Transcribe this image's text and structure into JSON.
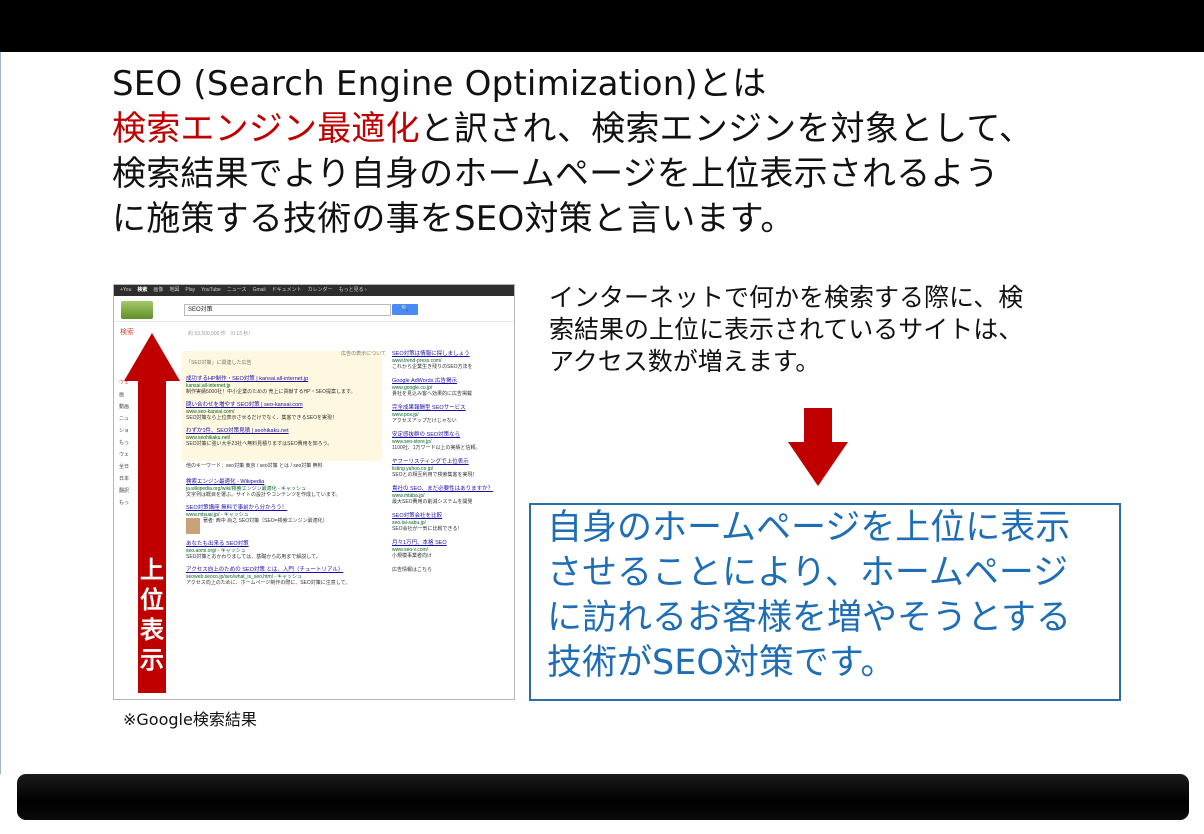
{
  "heading": {
    "line1": "SEO (Search Engine Optimization)とは",
    "line2_red": "検索エンジン最適化",
    "line2_rest": "と訳され、検索エンジンを対象として、",
    "line3": "検索結果でより自身のホームページを上位表示されるよう",
    "line4": "に施策する技術の事をSEO対策と言います。"
  },
  "screenshot": {
    "topbar_items": [
      "+You",
      "検索",
      "画像",
      "地図",
      "Play",
      "YouTube",
      "ニュース",
      "Gmail",
      "ドキュメント",
      "カレンダー",
      "もっと見る ›"
    ],
    "search_value": "SEO対策",
    "search_button": "🔍",
    "nav_label": "検索",
    "result_stats": "約 53,500,000 件 （0.13 秒）",
    "left_nav": [
      "ウェ",
      "画",
      "動画",
      "ニュ",
      "ショ",
      "もっ",
      "ウェ",
      "全日",
      "日本",
      "翻訳",
      "もっ"
    ],
    "ad_header": "「SEO対策」に関連した広告",
    "ad_header_right": "広告の表示について",
    "results": [
      {
        "title": "成功するHP制作・SEO対策 | kansai.all-internet.jp",
        "url": "kansai.all-internet.jp",
        "desc": "制作実績5000社！中小企業のための 売上に貢献するHP・SEO提案します。"
      },
      {
        "title": "問い合わせを増やす SEO対策 | seo-kansai.com",
        "url": "www.seo-kansai.com/",
        "desc": "SEO対策なら上位表示させるだけでなく、集客できるSEOを実現！"
      },
      {
        "title": "わずか1件、SEO対策見積 | seohikaku.net",
        "url": "www.seohikaku.net/",
        "desc": "SEO対策に強い大手23社へ無料見積りますはSEO費用を知ろう。"
      },
      {
        "title": "検索エンジン最適化 - Wikipedia",
        "url": "ja.wikipedia.org/wiki/検索エンジン最適化 - キャッシュ",
        "desc": "文字列は概目を選ぶ。サイトの設計やコンテンツを作成しています。"
      },
      {
        "title": "SEO対策講座 無料で事前から分かろう！",
        "url": "www.mtsuai.jp/ - キャッシュ",
        "desc": "著者: 西中 尚之 SEO対策（SEO=検索エンジン最適化）"
      },
      {
        "title": "あなたも出来る SEO対策",
        "url": "seo.aomi.org/ - キャッシュ",
        "desc": "SEO対策とおかわりましては、基礎から応用まで解説して。"
      },
      {
        "title": "アクセス向上のための SEO対策 とは、入門（チュートリアル）",
        "url": "seoweb.seoco.jp/seo/what_is_seo.html - キャッシュ",
        "desc": "アクセス向上のために、ホームページ制作の際に、SEO対策に注意して。"
      }
    ],
    "more_keywords": "他のキーワード：seo対策 東京 / seo対策 とは / seo対策 無料",
    "right_ads": [
      {
        "title": "SEO対策は情報に探しましょう",
        "url": "www.trend-press.com/",
        "desc": "これから企業生き残りのSEO方法を"
      },
      {
        "title": "Google AdWords 広告掲示",
        "url": "www.google.co.jp/",
        "desc": "貴社を見込み客へ効果的に広告掲載"
      },
      {
        "title": "完全成果報酬型 SEOサービス",
        "url": "www.pos.jp/",
        "desc": "アクセスアップだけじゃない"
      },
      {
        "title": "安定感抜群の SEO対策なら",
        "url": "www.seo-store.jp/",
        "desc": "1100社、1万ワード以上の実績と信頼。"
      },
      {
        "title": "ヤフーリスティングで上位表示",
        "url": "listing.yahoo.co.jp/",
        "desc": "SEOとの相互利用で検索集客を実現！"
      },
      {
        "title": "貴社の SEO、まだ必要性はありますか？",
        "url": "www.mtaba.jp/",
        "desc": "最大SEO費用の削減システムを開発"
      },
      {
        "title": "SEO対策会社を比較",
        "url": "seo.tai-sabu.jp/",
        "desc": "SEO会社が一気に比較できる！"
      },
      {
        "title": "月々1万円、本格 SEO",
        "url": "www.seo-v.com/",
        "desc": "小規模事業者向け"
      }
    ],
    "right_ads_more": "広告情報はこちら"
  },
  "up_arrow_label": "上位表示",
  "caption": "※Google検索結果",
  "paragraph": {
    "line1": "インターネットで何かを検索する際に、検",
    "line2": "索結果の上位に表示されているサイトは、",
    "line3": "アクセス数が増えます。"
  },
  "conclusion": {
    "line1": "自身のホームページを上位に表示",
    "line2": "させることにより、ホームページ",
    "line3": "に訪れるお客様を増やそうとする",
    "line4": "技術がSEO対策です。"
  },
  "colors": {
    "accent_red": "#c00000",
    "arrow_red": "#c00000",
    "conclusion_blue": "#1f6eb5",
    "box_border": "#2b6cab"
  }
}
